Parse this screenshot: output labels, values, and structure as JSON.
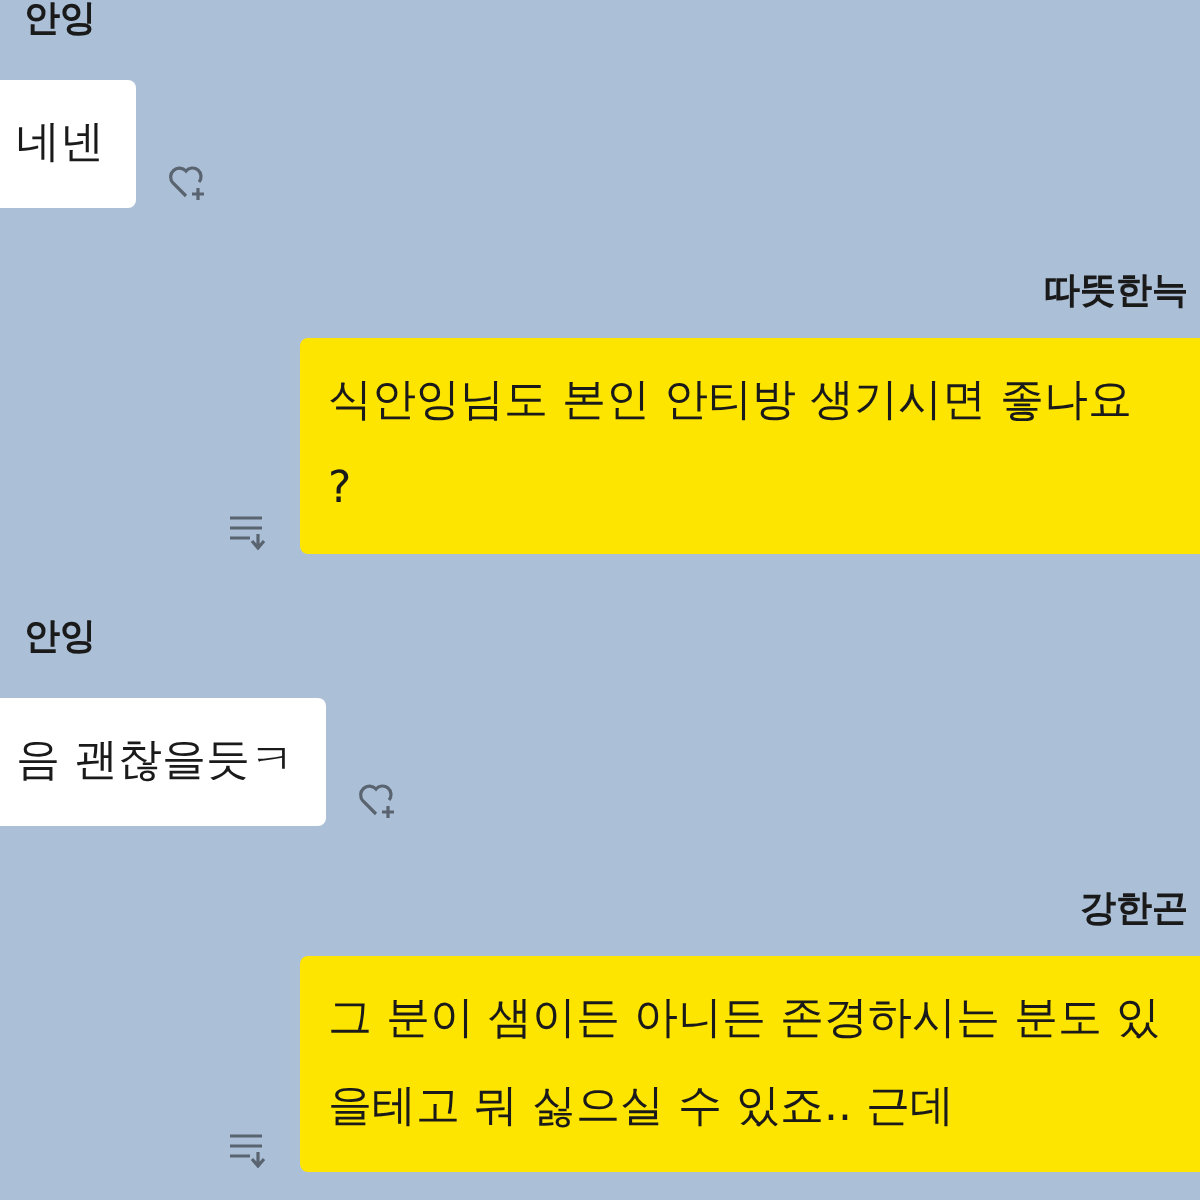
{
  "messages": [
    {
      "kind": "received",
      "sender": "안잉",
      "lines": [
        "네넨"
      ]
    },
    {
      "kind": "sent",
      "sender": "따뜻한늑",
      "lines": [
        "식안잉님도 본인 안티방 생기시면 좋나요",
        "?"
      ]
    },
    {
      "kind": "received",
      "sender": "안잉",
      "lines": [
        "음 괜찮을듯ㅋ"
      ]
    },
    {
      "kind": "sent",
      "sender": "강한곤",
      "lines": [
        "그 분이 샘이든 아니든 존경하시는 분도 있",
        "을테고 뭐 싫으실 수 있죠.. 근데"
      ]
    }
  ]
}
